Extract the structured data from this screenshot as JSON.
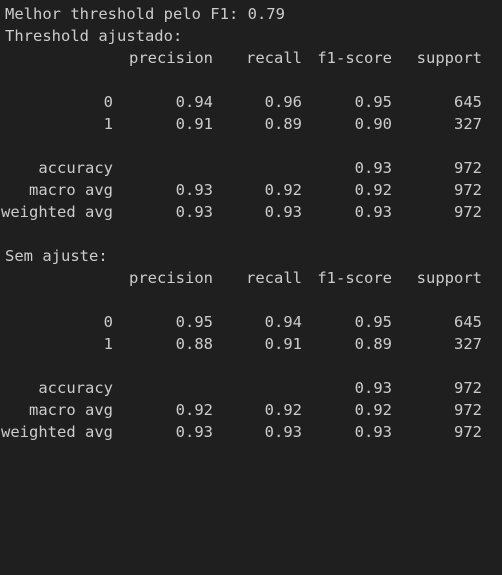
{
  "best_threshold_line": "Melhor threshold pelo F1: 0.79",
  "reports": [
    {
      "title": "Threshold ajustado:",
      "header": [
        "precision",
        "recall",
        "f1-score",
        "support"
      ],
      "rows": [
        {
          "label": "0",
          "precision": "0.94",
          "recall": "0.96",
          "f1": "0.95",
          "support": "645"
        },
        {
          "label": "1",
          "precision": "0.91",
          "recall": "0.89",
          "f1": "0.90",
          "support": "327"
        }
      ],
      "accuracy": {
        "label": "accuracy",
        "f1": "0.93",
        "support": "972"
      },
      "macro": {
        "label": "macro avg",
        "precision": "0.93",
        "recall": "0.92",
        "f1": "0.92",
        "support": "972"
      },
      "weighted": {
        "label": "weighted avg",
        "precision": "0.93",
        "recall": "0.93",
        "f1": "0.93",
        "support": "972"
      }
    },
    {
      "title": "Sem ajuste:",
      "header": [
        "precision",
        "recall",
        "f1-score",
        "support"
      ],
      "rows": [
        {
          "label": "0",
          "precision": "0.95",
          "recall": "0.94",
          "f1": "0.95",
          "support": "645"
        },
        {
          "label": "1",
          "precision": "0.88",
          "recall": "0.91",
          "f1": "0.89",
          "support": "327"
        }
      ],
      "accuracy": {
        "label": "accuracy",
        "f1": "0.93",
        "support": "972"
      },
      "macro": {
        "label": "macro avg",
        "precision": "0.92",
        "recall": "0.92",
        "f1": "0.92",
        "support": "972"
      },
      "weighted": {
        "label": "weighted avg",
        "precision": "0.93",
        "recall": "0.93",
        "f1": "0.93",
        "support": "972"
      }
    }
  ],
  "colors": {
    "background": "#1f1f1f",
    "text": "#cccccc"
  }
}
